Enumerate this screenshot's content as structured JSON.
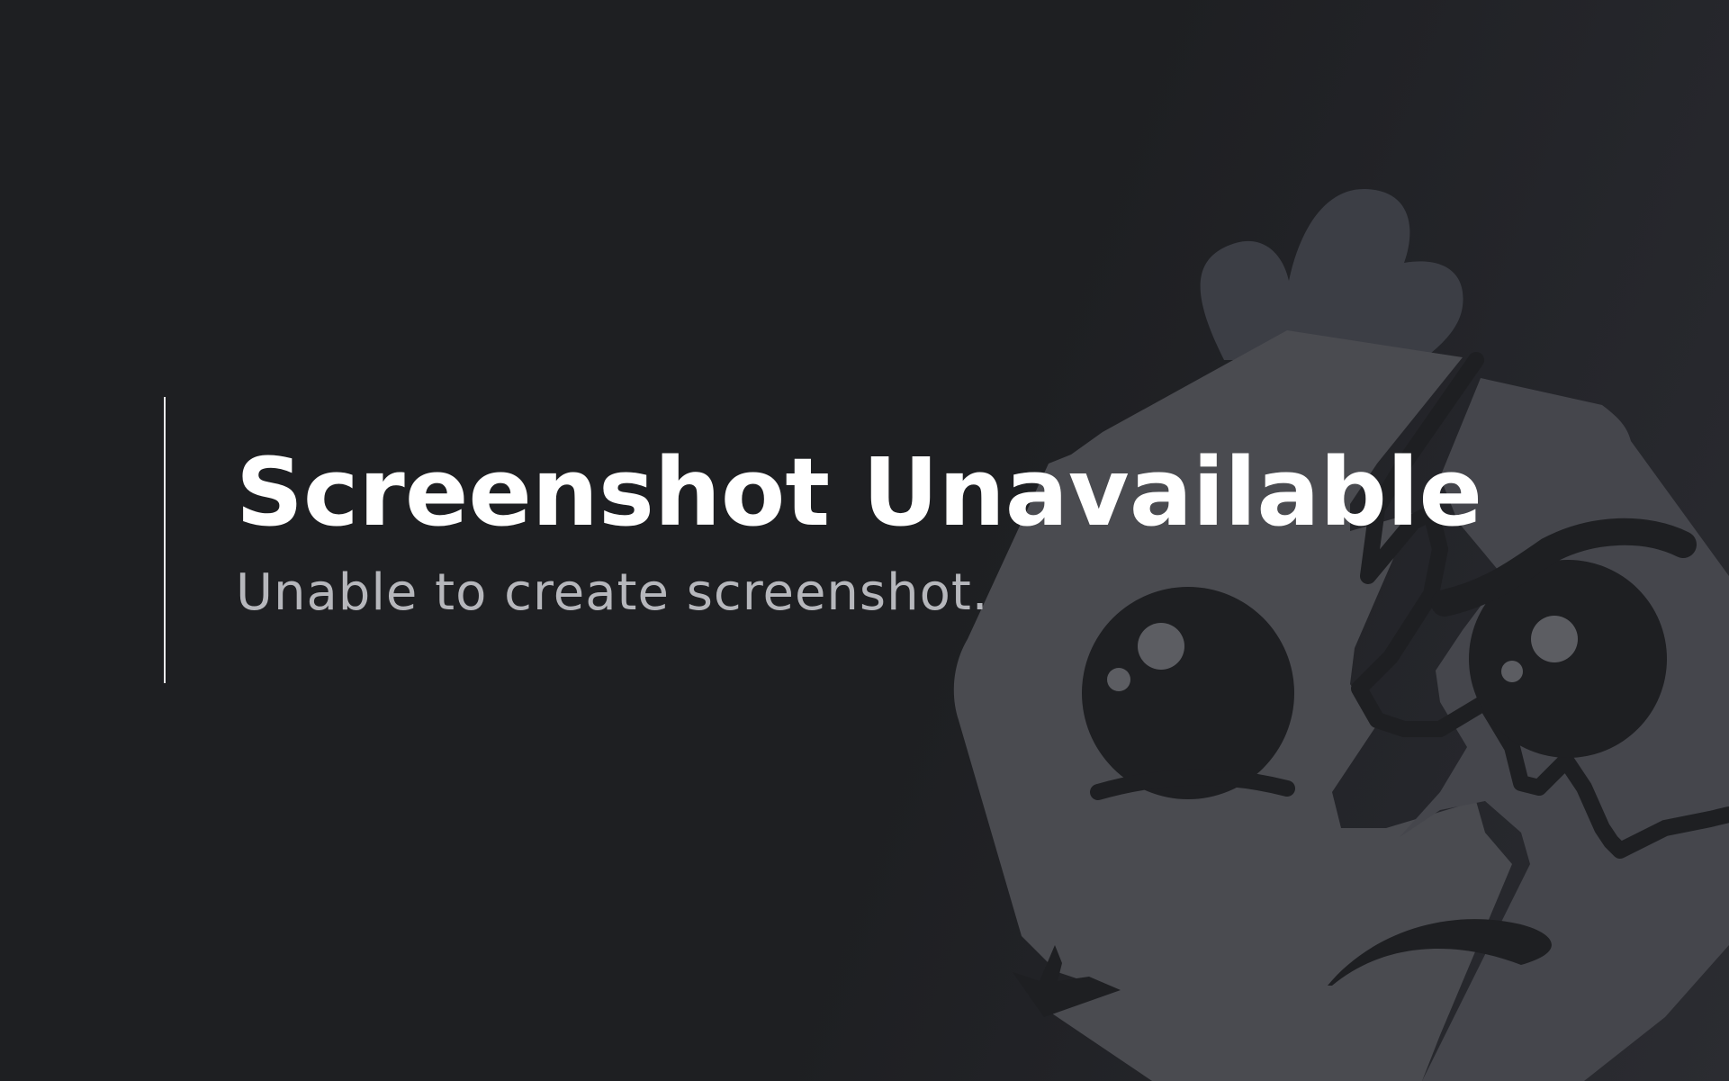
{
  "message": {
    "title": "Screenshot Unavailable",
    "subtitle": "Unable to create screenshot."
  },
  "illustration": {
    "name": "broken-faced-mascot",
    "colors": {
      "background": "#1e1f22",
      "body": "#4a4b50",
      "tuft": "#3c3e45",
      "features": "#1e1f22",
      "highlights": "#5c5d62"
    }
  }
}
